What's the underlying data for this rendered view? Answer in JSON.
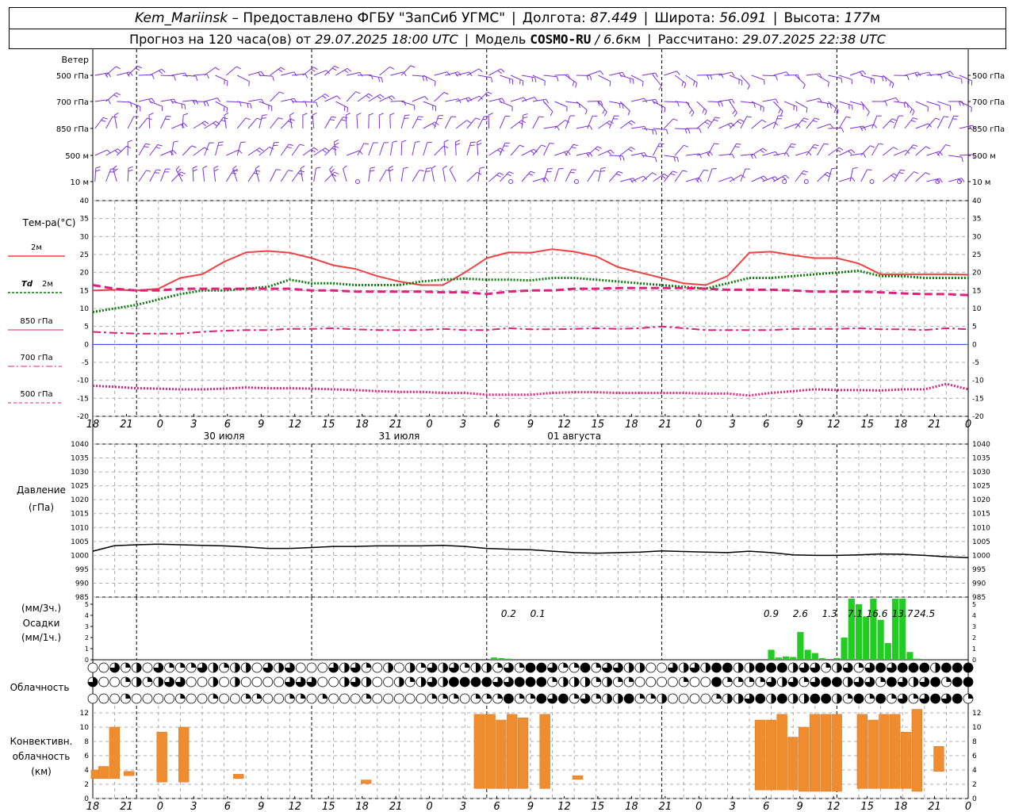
{
  "header": {
    "station": "Kem_Mariinsk",
    "provider": "– Предоставлено ФГБУ \"ЗапСиб УГМС\"",
    "lon_label": "Долгота:",
    "lon": "87.449",
    "lat_label": "Широта:",
    "lat": "56.091",
    "alt_label": "Высота:",
    "alt": "177",
    "alt_unit": "м",
    "fc_label": "Прогноз на 120 часа(ов) от",
    "fc_time": "29.07.2025 18:00 UTC",
    "model_label": "Модель",
    "model": "COSMO-RU",
    "model_res": "/ 6.6",
    "model_res_unit": "км",
    "calc_label": "Рассчитано:",
    "calc_time": "29.07.2025 22:38 UTC"
  },
  "wind": {
    "title": "Ветер",
    "levels": [
      "500 гПа",
      "700 гПа",
      "850 гПа",
      "500 м",
      "10  м"
    ],
    "color": "#7a32e0"
  },
  "time_axis": {
    "ticks": [
      "18",
      "21",
      "0",
      "3",
      "6",
      "9",
      "12",
      "15",
      "18",
      "21",
      "0",
      "3",
      "6",
      "9",
      "12",
      "15",
      "18",
      "21",
      "0",
      "3",
      "6",
      "9",
      "12",
      "15",
      "18",
      "21",
      "0"
    ],
    "days": [
      "30 июля",
      "31 июля",
      "01 августа"
    ]
  },
  "temp_legend": {
    "title": "Тем-ра(°С)",
    "t2m": "2м",
    "td_prefix": "Td",
    "td": "2м",
    "t850": "850 гПа",
    "t700": "700 гПа",
    "t500": "500 гПа"
  },
  "pressure_legend": {
    "title": "Давление",
    "unit": "(гПа)"
  },
  "precip_legend": {
    "unit3": "(мм/3ч.)",
    "title": "Осадки",
    "unit1": "(мм/1ч.)"
  },
  "cloud_legend": {
    "title": "Облачность"
  },
  "conv_legend": {
    "l1": "Конвективн.",
    "l2": "облачность",
    "l3": "(км)"
  },
  "colors": {
    "t2m": "#f04040",
    "td": "#0a7a0a",
    "t850": "#e0207a",
    "t700": "#e0207a",
    "t500": "#e0207a",
    "precip": "#22cc22",
    "conv": "#f08c30",
    "pressure": "#000000"
  },
  "chart_data": [
    {
      "type": "line",
      "title": "Тем-ра(°С)",
      "x_hours": [
        0,
        3,
        6,
        9,
        12,
        15,
        18,
        21,
        24,
        27,
        30,
        33,
        36,
        39,
        42,
        45,
        48,
        51,
        54,
        57,
        60,
        63,
        66,
        69,
        72,
        75,
        78,
        81,
        84,
        87,
        90,
        93,
        96,
        99,
        102,
        105,
        108,
        111,
        114,
        117,
        120
      ],
      "ylim": [
        -20,
        40
      ],
      "yticks": [
        -20,
        -15,
        -10,
        -5,
        0,
        5,
        10,
        15,
        20,
        25,
        30,
        35,
        40
      ],
      "series": [
        {
          "name": "2м",
          "style": "solid",
          "color": "#f04040",
          "values": [
            15,
            15.2,
            15,
            15.5,
            18.5,
            19.5,
            23,
            25.6,
            26,
            25.5,
            24,
            22,
            21,
            19,
            17.5,
            16.5,
            16.5,
            20,
            24,
            25.6,
            25.5,
            26.5,
            25.8,
            24.5,
            21.5,
            20,
            18.5,
            17,
            16.5,
            19,
            25.5,
            25.8,
            24.8,
            24,
            24,
            22.5,
            19.5,
            19.5,
            19.5,
            19.5,
            19.4
          ]
        },
        {
          "name": "Td 2м",
          "style": "dotted",
          "color": "#0a7a0a",
          "values": [
            9,
            10,
            11,
            12.5,
            14,
            15,
            15,
            15.5,
            16,
            18,
            17,
            17,
            16.5,
            16.5,
            16.5,
            17.5,
            18,
            18.3,
            18,
            18,
            17.8,
            18.5,
            18.5,
            18,
            17.5,
            17,
            16.5,
            16,
            15.5,
            17,
            18.5,
            18.5,
            19,
            19.5,
            20,
            20.5,
            19,
            19,
            18.5,
            18.5,
            18.5
          ]
        },
        {
          "name": "850 гПа",
          "style": "dashed",
          "color": "#e0207a",
          "values": [
            16.5,
            15.5,
            15,
            15,
            15.5,
            15.5,
            15.5,
            15.5,
            15.5,
            15.5,
            15,
            15,
            14.7,
            14.7,
            14.7,
            14.7,
            14.5,
            14.5,
            14,
            14.7,
            15,
            15,
            15.5,
            15.5,
            15.7,
            15.7,
            15.7,
            15.7,
            15.5,
            15.2,
            15.2,
            15.2,
            15,
            14.7,
            14.7,
            14.7,
            14.5,
            14.2,
            14,
            14,
            13.7
          ]
        },
        {
          "name": "700 гПа",
          "style": "dashdot",
          "color": "#e0207a",
          "values": [
            3.5,
            3.2,
            3,
            3,
            3,
            3.5,
            3.8,
            4,
            4,
            4.3,
            4.3,
            4.5,
            4.2,
            4,
            4,
            4,
            4.3,
            4,
            4,
            4.5,
            4.2,
            4.2,
            4.3,
            4.5,
            4.3,
            4.5,
            5,
            4.5,
            4,
            4,
            4,
            4,
            4.3,
            4.3,
            4.3,
            4.5,
            4.2,
            4.2,
            4,
            4.5,
            4.2
          ]
        },
        {
          "name": "500 гПа",
          "style": "dotted",
          "color": "#e0207a",
          "values": [
            -11.5,
            -11.8,
            -12.2,
            -12.3,
            -12.5,
            -12.5,
            -12.3,
            -12,
            -12.2,
            -12.2,
            -12.3,
            -12.5,
            -12.7,
            -13,
            -13.2,
            -13.2,
            -13.5,
            -13.5,
            -14,
            -14,
            -14,
            -13.5,
            -13.3,
            -13.3,
            -13.5,
            -13.5,
            -13.5,
            -13.5,
            -13.7,
            -13.7,
            -14.2,
            -13.5,
            -13,
            -12.5,
            -12.7,
            -12.7,
            -12.8,
            -12.5,
            -12.5,
            -11,
            -12.5
          ]
        }
      ]
    },
    {
      "type": "line",
      "title": "Давление",
      "ylabel": "(гПа)",
      "x_hours": [
        0,
        3,
        6,
        9,
        12,
        15,
        18,
        21,
        24,
        27,
        30,
        33,
        36,
        39,
        42,
        45,
        48,
        51,
        54,
        57,
        60,
        63,
        66,
        69,
        72,
        75,
        78,
        81,
        84,
        87,
        90,
        93,
        96,
        99,
        102,
        105,
        108,
        111,
        114,
        117,
        120
      ],
      "ylim": [
        985,
        1040
      ],
      "yticks": [
        985,
        990,
        995,
        1000,
        1005,
        1010,
        1015,
        1020,
        1025,
        1030,
        1035,
        1040
      ],
      "series": [
        {
          "name": "Давление",
          "values": [
            1001.5,
            1003.5,
            1003.8,
            1004,
            1003.8,
            1003.6,
            1003.4,
            1003,
            1002.5,
            1002.5,
            1002.8,
            1003.2,
            1003.2,
            1003.4,
            1003.4,
            1003.4,
            1003.6,
            1003.2,
            1002.5,
            1002.2,
            1002,
            1001.5,
            1001,
            1000.8,
            1001,
            1001.2,
            1001.6,
            1001.4,
            1001.2,
            1001,
            1001.5,
            1001,
            1000.2,
            1000,
            1000,
            1000.2,
            1000.5,
            1000.4,
            1000,
            999.5,
            999.2
          ]
        }
      ]
    },
    {
      "type": "bar",
      "title": "Осадки",
      "ylabel": "(мм/1ч.)",
      "ylim": [
        0,
        5.5
      ],
      "yticks": [
        0,
        1,
        2,
        3,
        4,
        5
      ],
      "bars_hourly": [
        {
          "h": 55,
          "v": 0.2
        },
        {
          "h": 56,
          "v": 0.15
        },
        {
          "h": 57,
          "v": 0.1
        },
        {
          "h": 93,
          "v": 0.9
        },
        {
          "h": 94,
          "v": 0.2
        },
        {
          "h": 95,
          "v": 0.3
        },
        {
          "h": 96,
          "v": 0.25
        },
        {
          "h": 97,
          "v": 2.5
        },
        {
          "h": 98,
          "v": 0.9
        },
        {
          "h": 99,
          "v": 0.6
        },
        {
          "h": 100,
          "v": 0.15
        },
        {
          "h": 102,
          "v": 0.15
        },
        {
          "h": 103,
          "v": 2.0
        },
        {
          "h": 104,
          "v": 5.5
        },
        {
          "h": 105,
          "v": 5.0
        },
        {
          "h": 106,
          "v": 3.9
        },
        {
          "h": 107,
          "v": 5.5
        },
        {
          "h": 108,
          "v": 3.6
        },
        {
          "h": 109,
          "v": 1.5
        },
        {
          "h": 110,
          "v": 5.5
        },
        {
          "h": 111,
          "v": 5.5
        },
        {
          "h": 112,
          "v": 0.7
        },
        {
          "h": 113,
          "v": 0.1
        }
      ],
      "totals_3h": [
        {
          "h": 57,
          "label": "0.2"
        },
        {
          "h": 61,
          "label": "0.1"
        },
        {
          "h": 93,
          "label": "0.9"
        },
        {
          "h": 97,
          "label": "2.6"
        },
        {
          "h": 101,
          "label": "1.3"
        },
        {
          "h": 104.5,
          "label": "7.1"
        },
        {
          "h": 107.5,
          "label": "16.6"
        },
        {
          "h": 111,
          "label": "13.7"
        },
        {
          "h": 114,
          "label": "24.5"
        }
      ]
    },
    {
      "type": "bar",
      "title": "Конвективн. облачность (км)",
      "ylim": [
        0,
        13
      ],
      "yticks": [
        0,
        2,
        4,
        6,
        8,
        10,
        12
      ],
      "bars": [
        {
          "h": 0.5,
          "bottom": 2.8,
          "top": 4.0
        },
        {
          "h": 1.5,
          "bottom": 2.8,
          "top": 4.5
        },
        {
          "h": 3,
          "bottom": 2.8,
          "top": 10
        },
        {
          "h": 5,
          "bottom": 3.2,
          "top": 3.8
        },
        {
          "h": 9.5,
          "bottom": 2.3,
          "top": 9.3
        },
        {
          "h": 12.5,
          "bottom": 2.3,
          "top": 10
        },
        {
          "h": 20,
          "bottom": 2.8,
          "top": 3.4
        },
        {
          "h": 37.5,
          "bottom": 2.1,
          "top": 2.6
        },
        {
          "h": 53,
          "bottom": 1.4,
          "top": 11.8
        },
        {
          "h": 54.5,
          "bottom": 1.4,
          "top": 11.8
        },
        {
          "h": 56,
          "bottom": 1.4,
          "top": 11.0
        },
        {
          "h": 57.5,
          "bottom": 1.4,
          "top": 11.8
        },
        {
          "h": 59,
          "bottom": 1.4,
          "top": 11.3
        },
        {
          "h": 62,
          "bottom": 1.4,
          "top": 11.8
        },
        {
          "h": 66.5,
          "bottom": 2.7,
          "top": 3.2
        },
        {
          "h": 91.5,
          "bottom": 1.2,
          "top": 11.0
        },
        {
          "h": 93,
          "bottom": 1.2,
          "top": 11.0
        },
        {
          "h": 94.5,
          "bottom": 1.2,
          "top": 11.8
        },
        {
          "h": 96,
          "bottom": 1.2,
          "top": 8.6
        },
        {
          "h": 97.5,
          "bottom": 1.0,
          "top": 10.0
        },
        {
          "h": 99,
          "bottom": 1.0,
          "top": 11.8
        },
        {
          "h": 100.5,
          "bottom": 1.0,
          "top": 11.8
        },
        {
          "h": 102,
          "bottom": 1.0,
          "top": 11.8
        },
        {
          "h": 105.5,
          "bottom": 1.4,
          "top": 11.8
        },
        {
          "h": 107,
          "bottom": 1.4,
          "top": 11.0
        },
        {
          "h": 108.5,
          "bottom": 1.4,
          "top": 11.8
        },
        {
          "h": 110,
          "bottom": 1.4,
          "top": 11.8
        },
        {
          "h": 111.5,
          "bottom": 1.4,
          "top": 9.3
        },
        {
          "h": 113,
          "bottom": 1.0,
          "top": 12.5
        },
        {
          "h": 116,
          "bottom": 3.8,
          "top": 7.3
        }
      ]
    }
  ]
}
